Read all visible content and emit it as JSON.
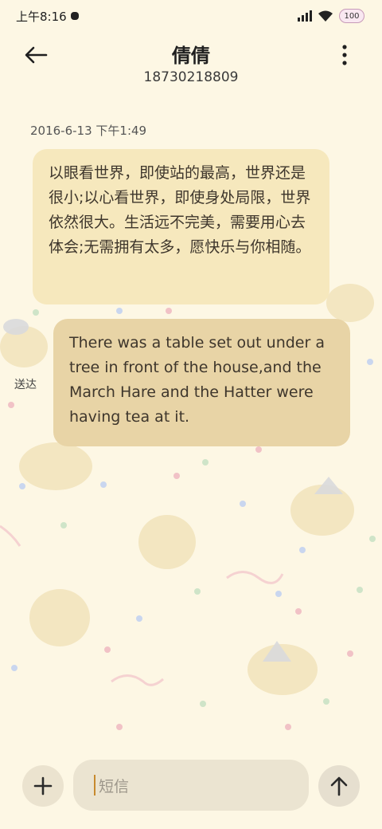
{
  "status_bar": {
    "time": "上午8:16",
    "battery": "100"
  },
  "header": {
    "contact_name": "倩倩",
    "contact_number": "18730218809"
  },
  "conversation": {
    "timestamp": "2016-6-13 下午1:49",
    "messages": [
      {
        "direction": "received",
        "text": "以眼看世界，即使站的最高，世界还是很小;以心看世界，即使身处局限，世界依然很大。生活远不完美，需要用心去体会;无需拥有太多，愿快乐与你相随。"
      },
      {
        "direction": "sent",
        "text": "There was a table set out under a tree in front of the house,and the March Hare and the Hatter were having tea at it."
      }
    ],
    "delivery_status": "送达"
  },
  "composer": {
    "placeholder": "短信"
  },
  "colors": {
    "background": "#fdf7e4",
    "received_bubble": "#f6e8bd",
    "sent_bubble": "#e8d4a6",
    "caret": "#c78a2e"
  },
  "icons": [
    "signal-icon",
    "wifi-icon",
    "battery-icon",
    "back-arrow-icon",
    "more-vertical-icon",
    "plus-icon",
    "send-arrow-icon",
    "record-icon"
  ]
}
